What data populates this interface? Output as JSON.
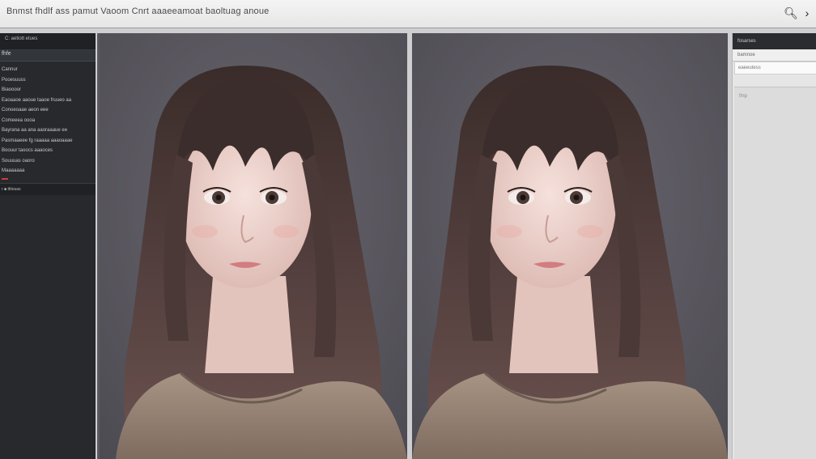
{
  "toolbar": {
    "menu_text": "Bnmst fhdlf ass pamut Vaoom Cnrt aaaeeamoat baoltuag anoue",
    "icons": [
      "search-icon",
      "chevron-right-icon"
    ]
  },
  "left_panel": {
    "header": "C: aetiott etues",
    "field_value": "fhfe",
    "items": [
      "Cannur",
      "Pooesuuss",
      "Biaoooor",
      "Eaoaaoe aaoue taaoe fruueo aa",
      "Conoeoaae aeon eee",
      "Comeeea oooa",
      "Bayrana aa ana aaoraaaue ee",
      "Pasmaaeee fg raaaaa aaaoaaae",
      "Boouur taoocs aaaoces",
      "Souuuas oaoro",
      "Maaaaaaa"
    ],
    "footer": "r ■ tttiouas"
  },
  "right_panel": {
    "header": "fosarses",
    "row1": "bamnoe",
    "row2": "eaeeutess",
    "content_label": "fmp"
  },
  "colors": {
    "toolbar_bg": "#ececec",
    "left_panel_bg": "#27292c",
    "viewport_bg": "#58565e",
    "right_panel_bg": "#e6e6e6",
    "accent": "#d23a3a"
  }
}
